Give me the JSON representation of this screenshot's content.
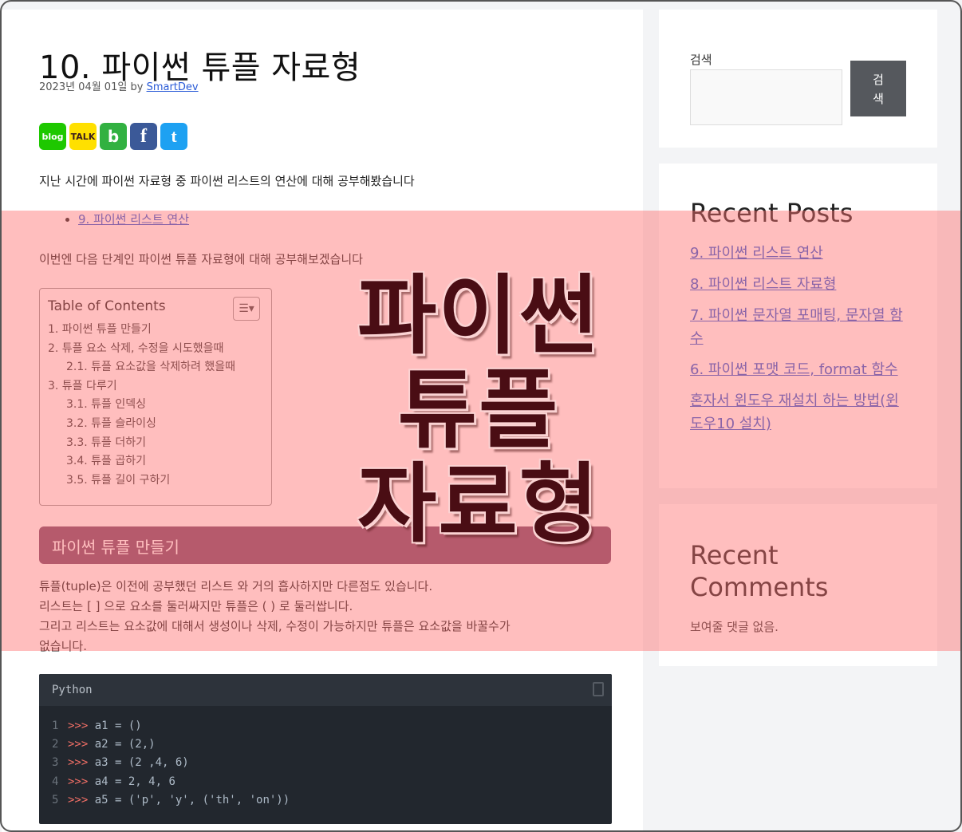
{
  "post": {
    "title": "10. 파이썬 튜플 자료형",
    "date": "2023년 04월 01일",
    "by": "by",
    "author": "SmartDev",
    "share": {
      "blog": "blog",
      "talk": "TALK",
      "band": "b",
      "facebook": "f",
      "twitter": "t"
    },
    "intro": "지난 시간에 파이썬 자료형 중 파이썬 리스트의 연산에 대해 공부해봤습니다",
    "prev_link": "9. 파이썬 리스트 연산",
    "lead": "이번엔 다음 단계인 파이썬 튜플 자료형에 대해 공부해보겠습니다",
    "toc": {
      "title": "Table of Contents",
      "items": [
        "1. 파이썬 튜플 만들기",
        "2. 튜플 요소 삭제, 수정을 시도했을때",
        "2.1. 튜플 요소값을 삭제하려 했을때",
        "3. 튜플 다루기",
        "3.1. 튜플 인덱싱",
        "3.2. 튜플 슬라이싱",
        "3.3. 튜플 더하기",
        "3.4. 튜플 곱하기",
        "3.5. 튜플 길이 구하기"
      ]
    },
    "section_heading": "파이썬 튜플 만들기",
    "body": [
      "튜플(tuple)은 이전에 공부했던 리스트 와 거의 흡사하지만 다른점도 있습니다.",
      "리스트는 [ ] 으로 요소를 둘러싸지만 튜플은 ( ) 로 둘러쌉니다.",
      "그리고 리스트는 요소값에 대해서 생성이나 삭제, 수정이 가능하지만 튜플은 요소값을 바꿀수가",
      "없습니다."
    ],
    "code": {
      "language": "Python",
      "lines": [
        {
          "n": "1",
          "prompt": ">>>",
          "text": " a1 = ()"
        },
        {
          "n": "2",
          "prompt": ">>>",
          "text": " a2 = (2,)"
        },
        {
          "n": "3",
          "prompt": ">>>",
          "text": " a3 = (2 ,4, 6)"
        },
        {
          "n": "4",
          "prompt": ">>>",
          "text": " a4 = 2, 4, 6"
        },
        {
          "n": "5",
          "prompt": ">>>",
          "text": " a5 = ('p', 'y', ('th', 'on'))"
        }
      ]
    }
  },
  "sidebar": {
    "search_label": "검색",
    "search_button": "검\n색",
    "recent_posts_title": "Recent Posts",
    "recent_posts": [
      "9. 파이썬 리스트 연산",
      "8. 파이썬 리스트 자료형",
      "7. 파이썬 문자열 포매팅, 문자열 함수",
      "6. 파이썬 포맷 코드, format 함수",
      "혼자서 윈도우 재설치 하는 방법(윈도우10 설치)"
    ],
    "recent_comments_title": "Recent Comments",
    "no_comments": "보여줄 댓글 없음."
  },
  "banner": {
    "lines": [
      "파이썬",
      "튜플",
      "자료형"
    ]
  }
}
